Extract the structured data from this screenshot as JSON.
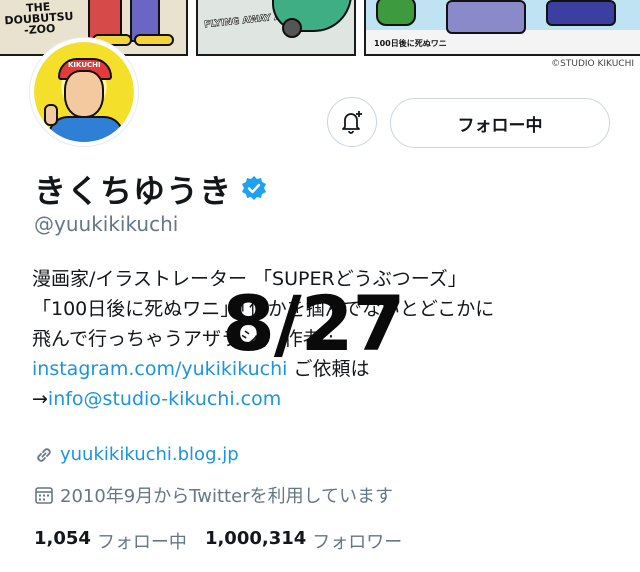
{
  "banner": {
    "panel1_text": "THE DOUBUTSU -ZOO",
    "panel2_text": "FLYING AWAY AZARASHI",
    "panel3_text": "100日後に死ぬワニ",
    "credit": "©STUDIO KIKUCHI"
  },
  "avatar": {
    "cap_text": "KIKUCHI"
  },
  "actions": {
    "notify_icon": "bell-plus-icon",
    "follow_label": "フォロー中"
  },
  "profile": {
    "display_name": "きくちゆうき",
    "verified_icon": "verified-badge-icon",
    "handle": "@yuukikikuchi"
  },
  "bio": {
    "line1": "漫画家/イラストレーター 「SUPERどうぶつーズ」",
    "line2": "「100日後に死ぬワニ」「何かを掴んでないとどこかに",
    "line3": "飛んで行っちゃうアザラシ」 作者 :",
    "link_instagram": "instagram.com/yukikikuchi",
    "line4_suffix": " ご依頼は",
    "arrow": "→",
    "email": "info@studio-kikuchi.com"
  },
  "overlay_text": "8/27",
  "meta": {
    "link_icon": "link-icon",
    "website": "yuukikikuchi.blog.jp",
    "calendar_icon": "calendar-icon",
    "joined": "2010年9月からTwitterを利用しています"
  },
  "stats": {
    "following_count": "1,054",
    "following_label": "フォロー中",
    "followers_count": "1,000,314",
    "followers_label": "フォロワー"
  },
  "colors": {
    "accent": "#1b95e0",
    "secondary_text": "#657786",
    "primary_text": "#14171a",
    "border": "#ccd6dd"
  }
}
